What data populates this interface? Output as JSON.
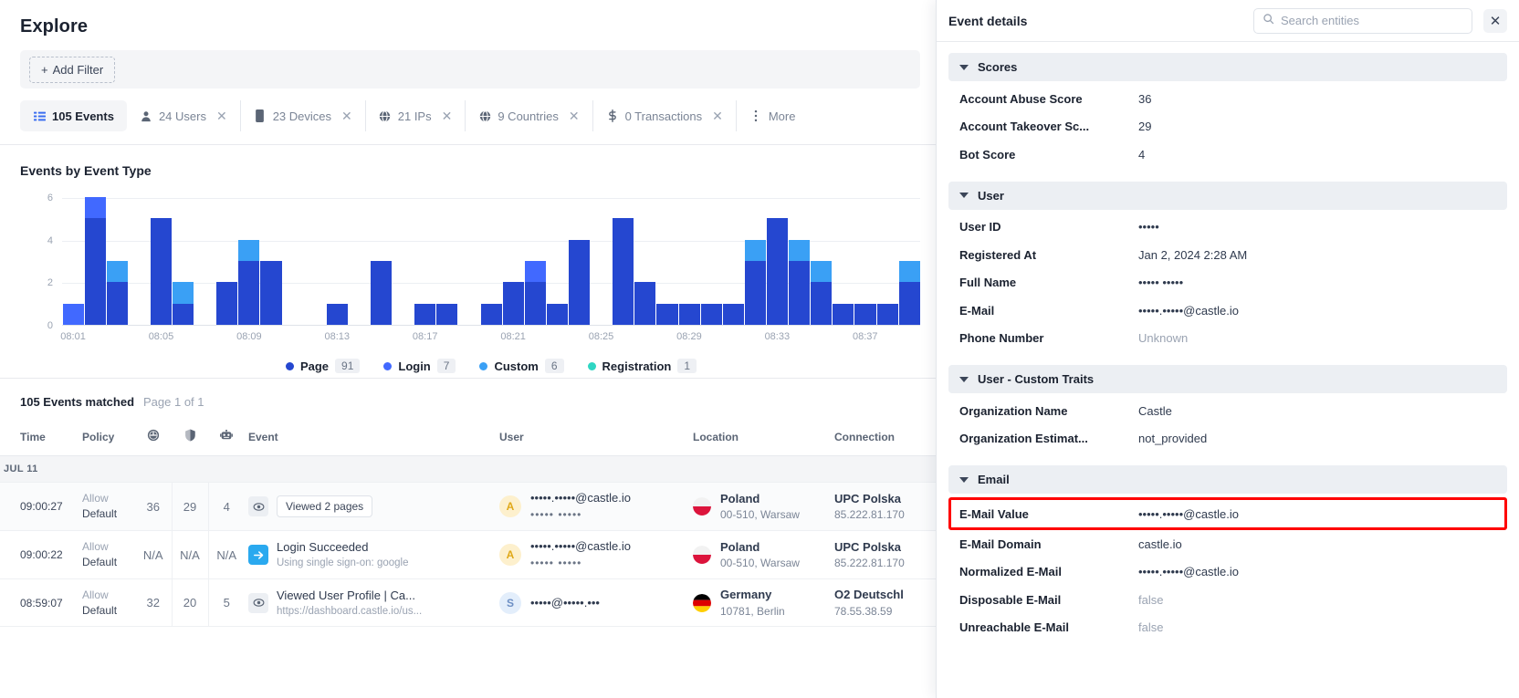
{
  "header": {
    "title": "Explore"
  },
  "filter_bar": {
    "add_filter_label": "Add Filter"
  },
  "entity_tabs": [
    {
      "label": "105 Events",
      "icon": "list-icon",
      "active": true,
      "closable": false
    },
    {
      "label": "24 Users",
      "icon": "user-icon",
      "active": false,
      "closable": true
    },
    {
      "label": "23 Devices",
      "icon": "device-icon",
      "active": false,
      "closable": true
    },
    {
      "label": "21 IPs",
      "icon": "globe-icon",
      "active": false,
      "closable": true
    },
    {
      "label": "9 Countries",
      "icon": "globe-icon",
      "active": false,
      "closable": true
    },
    {
      "label": "0 Transactions",
      "icon": "dollar-icon",
      "active": false,
      "closable": true
    },
    {
      "label": "More",
      "icon": "kebab-icon",
      "active": false,
      "closable": false
    }
  ],
  "chart_data": {
    "type": "bar",
    "title": "Events by Event Type",
    "stacked": true,
    "xlabel": "",
    "ylabel": "",
    "ylim": [
      0,
      6
    ],
    "yticks": [
      0,
      2,
      4,
      6
    ],
    "grid": true,
    "legend_position": "bottom",
    "legend": [
      {
        "name": "Page",
        "count": 91,
        "color": "#2547d0"
      },
      {
        "name": "Login",
        "count": 7,
        "color": "#4169ff"
      },
      {
        "name": "Custom",
        "count": 6,
        "color": "#3aa0f5"
      },
      {
        "name": "Registration",
        "count": 1,
        "color": "#2fd6c3"
      }
    ],
    "x_tick_labels": [
      "08:01",
      "08:05",
      "08:09",
      "08:13",
      "08:17",
      "08:21",
      "08:25",
      "08:29",
      "08:33",
      "08:37"
    ],
    "x_tick_indices": [
      0,
      4,
      8,
      12,
      16,
      20,
      24,
      28,
      32,
      36
    ],
    "categories": [
      "08:00",
      "08:01",
      "08:02",
      "08:03",
      "08:04",
      "08:05",
      "08:06",
      "08:07",
      "08:08",
      "08:09",
      "08:10",
      "08:11",
      "08:12",
      "08:13",
      "08:14",
      "08:15",
      "08:16",
      "08:17",
      "08:18",
      "08:19",
      "08:20",
      "08:21",
      "08:22",
      "08:23",
      "08:24",
      "08:25",
      "08:26",
      "08:27",
      "08:28",
      "08:29",
      "08:30",
      "08:31",
      "08:32",
      "08:33",
      "08:34",
      "08:35",
      "08:36",
      "08:37",
      "08:38"
    ],
    "series": [
      {
        "name": "Page",
        "color": "#2547d0",
        "values": [
          0,
          5,
          2,
          0,
          5,
          1,
          0,
          2,
          3,
          3,
          0,
          0,
          1,
          0,
          3,
          0,
          1,
          1,
          0,
          1,
          2,
          2,
          1,
          4,
          0,
          5,
          2,
          1,
          1,
          1,
          1,
          3,
          5,
          3,
          2,
          1,
          1,
          1,
          2
        ]
      },
      {
        "name": "Login",
        "color": "#4169ff",
        "values": [
          1,
          1,
          0,
          0,
          0,
          0,
          0,
          0,
          0,
          0,
          0,
          0,
          0,
          0,
          0,
          0,
          0,
          0,
          0,
          0,
          0,
          1,
          0,
          0,
          0,
          0,
          0,
          0,
          0,
          0,
          0,
          0,
          0,
          0,
          0,
          0,
          0,
          0,
          0
        ]
      },
      {
        "name": "Custom",
        "color": "#3aa0f5",
        "values": [
          0,
          0,
          1,
          0,
          0,
          1,
          0,
          0,
          1,
          0,
          0,
          0,
          0,
          0,
          0,
          0,
          0,
          0,
          0,
          0,
          0,
          0,
          0,
          0,
          0,
          0,
          0,
          0,
          0,
          0,
          0,
          1,
          0,
          1,
          1,
          0,
          0,
          0,
          1
        ]
      },
      {
        "name": "Registration",
        "color": "#2fd6c3",
        "values": [
          0,
          0,
          0,
          0,
          0,
          0,
          0,
          0,
          0,
          0,
          0,
          0,
          0,
          0,
          0,
          0,
          0,
          0,
          0,
          0,
          0,
          0,
          0,
          0,
          0,
          0,
          0,
          0,
          0,
          0,
          0,
          0,
          0,
          0,
          0,
          0,
          0,
          0,
          0
        ]
      }
    ]
  },
  "results": {
    "count_label": "105 Events matched",
    "page_label": "Page 1 of 1"
  },
  "table": {
    "columns": [
      {
        "key": "time",
        "label": "Time"
      },
      {
        "key": "policy",
        "label": "Policy"
      },
      {
        "key": "abuse",
        "label": "",
        "icon": "gauge-icon"
      },
      {
        "key": "takeover",
        "label": "",
        "icon": "shield-icon"
      },
      {
        "key": "bot",
        "label": "",
        "icon": "robot-icon"
      },
      {
        "key": "event",
        "label": "Event"
      },
      {
        "key": "user",
        "label": "User"
      },
      {
        "key": "location",
        "label": "Location"
      },
      {
        "key": "connection",
        "label": "Connection"
      }
    ],
    "day_separator": "JUL 11",
    "rows": [
      {
        "time": "09:00:27",
        "policy_action": "Allow",
        "policy_name": "Default",
        "abuse": "36",
        "takeover": "29",
        "bot": "4",
        "event_icon": "eye-icon",
        "event_pill": "Viewed 2 pages",
        "event_title": "",
        "event_sub": "",
        "user_initial": "A",
        "user_email": "•••••.•••••@castle.io",
        "user_sub": "••••• •••••",
        "country": "Poland",
        "city": "00-510, Warsaw",
        "flag": "poland",
        "conn_isp": "UPC Polska",
        "conn_ip": "85.222.81.170"
      },
      {
        "time": "09:00:22",
        "policy_action": "Allow",
        "policy_name": "Default",
        "abuse": "N/A",
        "takeover": "N/A",
        "bot": "N/A",
        "event_icon": "arrow-right-icon",
        "event_pill": "",
        "event_title": "Login Succeeded",
        "event_sub": "Using single sign-on: google",
        "user_initial": "A",
        "user_email": "•••••.•••••@castle.io",
        "user_sub": "••••• •••••",
        "country": "Poland",
        "city": "00-510, Warsaw",
        "flag": "poland",
        "conn_isp": "UPC Polska",
        "conn_ip": "85.222.81.170"
      },
      {
        "time": "08:59:07",
        "policy_action": "Allow",
        "policy_name": "Default",
        "abuse": "32",
        "takeover": "20",
        "bot": "5",
        "event_icon": "eye-icon",
        "event_pill": "",
        "event_title": "Viewed User Profile | Ca...",
        "event_sub": "https://dashboard.castle.io/us...",
        "user_initial": "S",
        "user_email": "•••••@•••••.•••",
        "user_sub": "",
        "country": "Germany",
        "city": "10781, Berlin",
        "flag": "germany",
        "conn_isp": "O2 Deutschl",
        "conn_ip": "78.55.38.59"
      }
    ]
  },
  "panel": {
    "title": "Event details",
    "search_placeholder": "Search entities",
    "search_value": "",
    "close_label": "✕",
    "sections": [
      {
        "title": "Scores",
        "rows": [
          {
            "key": "Account Abuse Score",
            "value": "36",
            "muted": false,
            "highlight": false
          },
          {
            "key": "Account Takeover Sc...",
            "value": "29",
            "muted": false,
            "highlight": false
          },
          {
            "key": "Bot Score",
            "value": "4",
            "muted": false,
            "highlight": false
          }
        ]
      },
      {
        "title": "User",
        "rows": [
          {
            "key": "User ID",
            "value": "•••••",
            "muted": false,
            "highlight": false
          },
          {
            "key": "Registered At",
            "value": "Jan 2, 2024 2:28 AM",
            "muted": false,
            "highlight": false
          },
          {
            "key": "Full Name",
            "value": "••••• •••••",
            "muted": false,
            "highlight": false
          },
          {
            "key": "E-Mail",
            "value": "•••••.•••••@castle.io",
            "muted": false,
            "highlight": false
          },
          {
            "key": "Phone Number",
            "value": "Unknown",
            "muted": true,
            "highlight": false
          }
        ]
      },
      {
        "title": "User - Custom Traits",
        "rows": [
          {
            "key": "Organization Name",
            "value": "Castle",
            "muted": false,
            "highlight": false
          },
          {
            "key": "Organization Estimat...",
            "value": "not_provided",
            "muted": false,
            "highlight": false
          }
        ]
      },
      {
        "title": "Email",
        "rows": [
          {
            "key": "E-Mail Value",
            "value": "•••••.•••••@castle.io",
            "muted": false,
            "highlight": true
          },
          {
            "key": "E-Mail Domain",
            "value": "castle.io",
            "muted": false,
            "highlight": false
          },
          {
            "key": "Normalized E-Mail",
            "value": "•••••.•••••@castle.io",
            "muted": false,
            "highlight": false
          },
          {
            "key": "Disposable E-Mail",
            "value": "false",
            "muted": true,
            "highlight": false
          },
          {
            "key": "Unreachable E-Mail",
            "value": "false",
            "muted": true,
            "highlight": false
          }
        ]
      }
    ]
  }
}
